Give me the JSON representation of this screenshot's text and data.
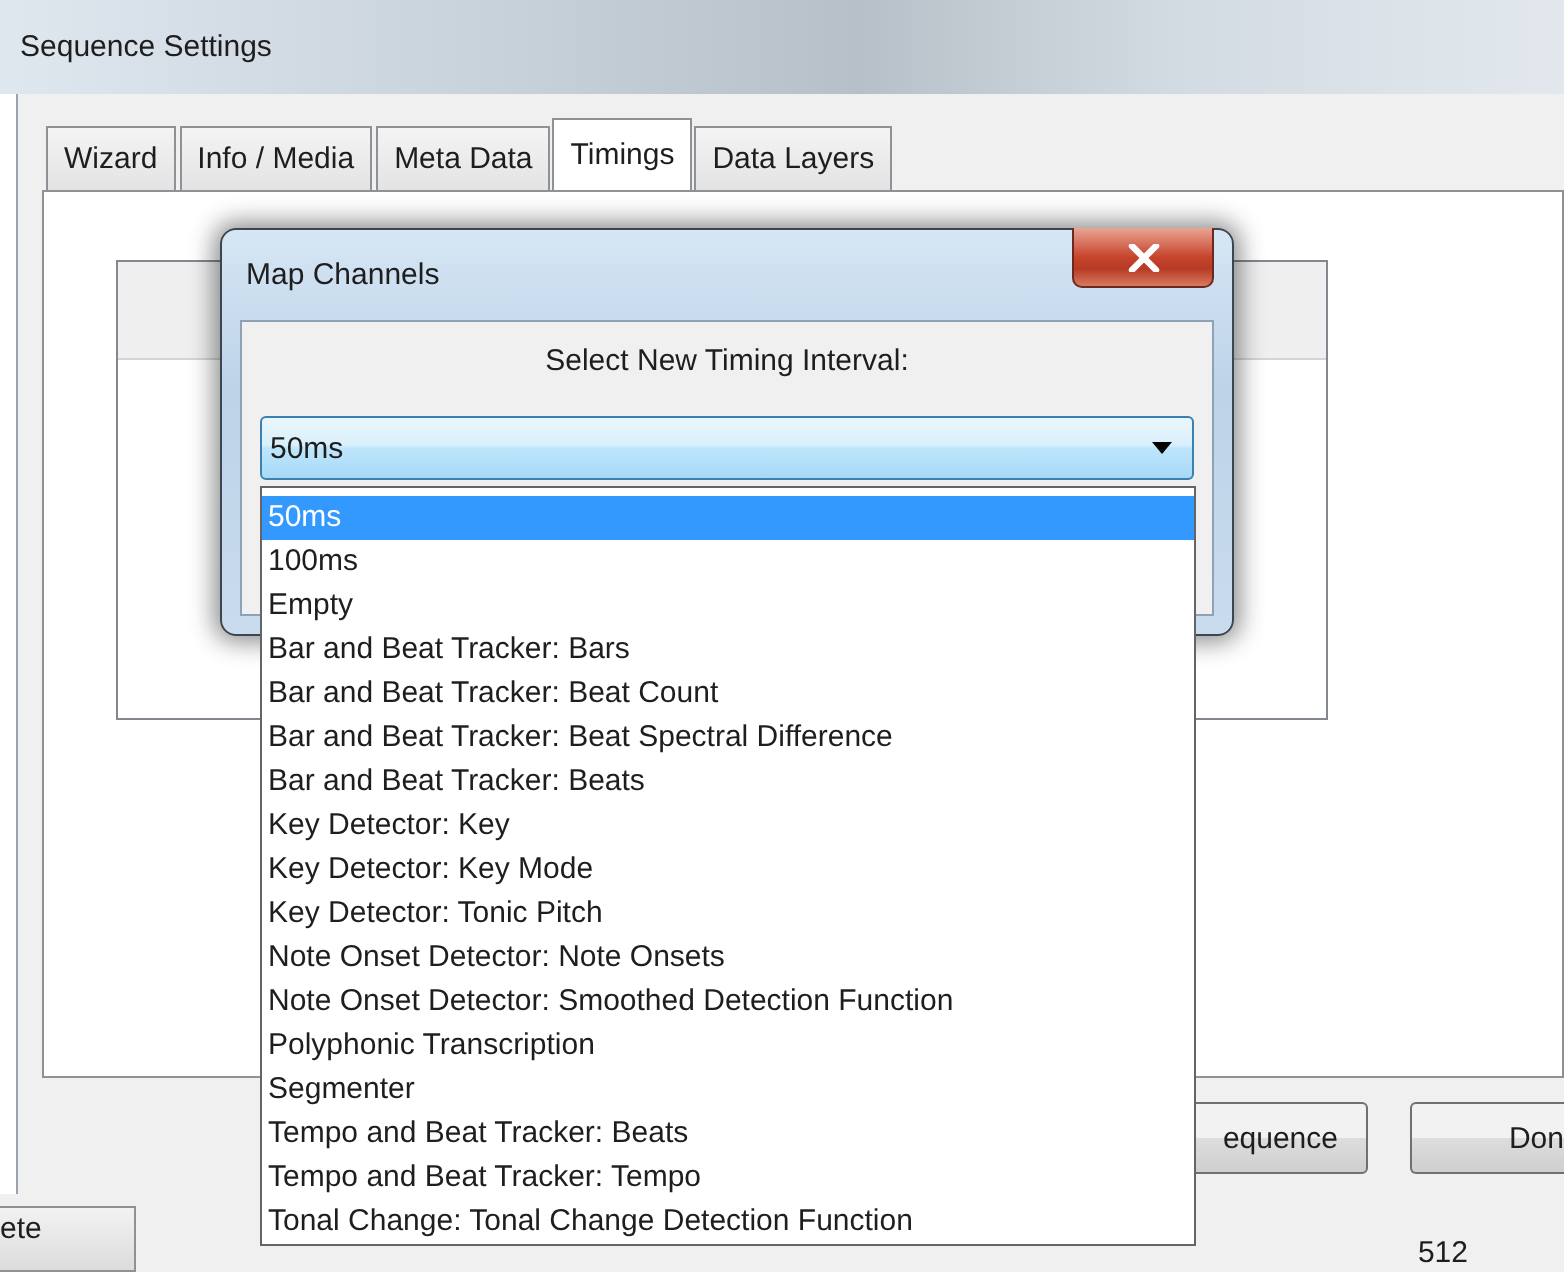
{
  "window": {
    "title": "Sequence Settings"
  },
  "tabs": [
    {
      "label": "Wizard",
      "selected": false
    },
    {
      "label": "Info / Media",
      "selected": false
    },
    {
      "label": "Meta Data",
      "selected": false
    },
    {
      "label": "Timings",
      "selected": true
    },
    {
      "label": "Data Layers",
      "selected": false
    }
  ],
  "buttons": [
    {
      "label": "equence"
    },
    {
      "label": "Don"
    }
  ],
  "background_row": {
    "button": "ete",
    "value": "512"
  },
  "dialog": {
    "title": "Map Channels",
    "prompt": "Select New Timing Interval:",
    "combo": {
      "value": "50ms"
    },
    "options": [
      {
        "label": "50ms",
        "selected": true
      },
      {
        "label": "100ms",
        "selected": false
      },
      {
        "label": "Empty",
        "selected": false
      },
      {
        "label": "Bar and Beat Tracker: Bars",
        "selected": false
      },
      {
        "label": "Bar and Beat Tracker: Beat Count",
        "selected": false
      },
      {
        "label": "Bar and Beat Tracker: Beat Spectral Difference",
        "selected": false
      },
      {
        "label": "Bar and Beat Tracker: Beats",
        "selected": false
      },
      {
        "label": "Key Detector: Key",
        "selected": false
      },
      {
        "label": "Key Detector: Key Mode",
        "selected": false
      },
      {
        "label": "Key Detector: Tonic Pitch",
        "selected": false
      },
      {
        "label": "Note Onset Detector: Note Onsets",
        "selected": false
      },
      {
        "label": "Note Onset Detector: Smoothed Detection Function",
        "selected": false
      },
      {
        "label": "Polyphonic Transcription",
        "selected": false
      },
      {
        "label": "Segmenter",
        "selected": false
      },
      {
        "label": "Tempo and Beat Tracker: Beats",
        "selected": false
      },
      {
        "label": "Tempo and Beat Tracker: Tempo",
        "selected": false
      },
      {
        "label": "Tonal Change: Tonal Change Detection Function",
        "selected": false
      }
    ]
  }
}
